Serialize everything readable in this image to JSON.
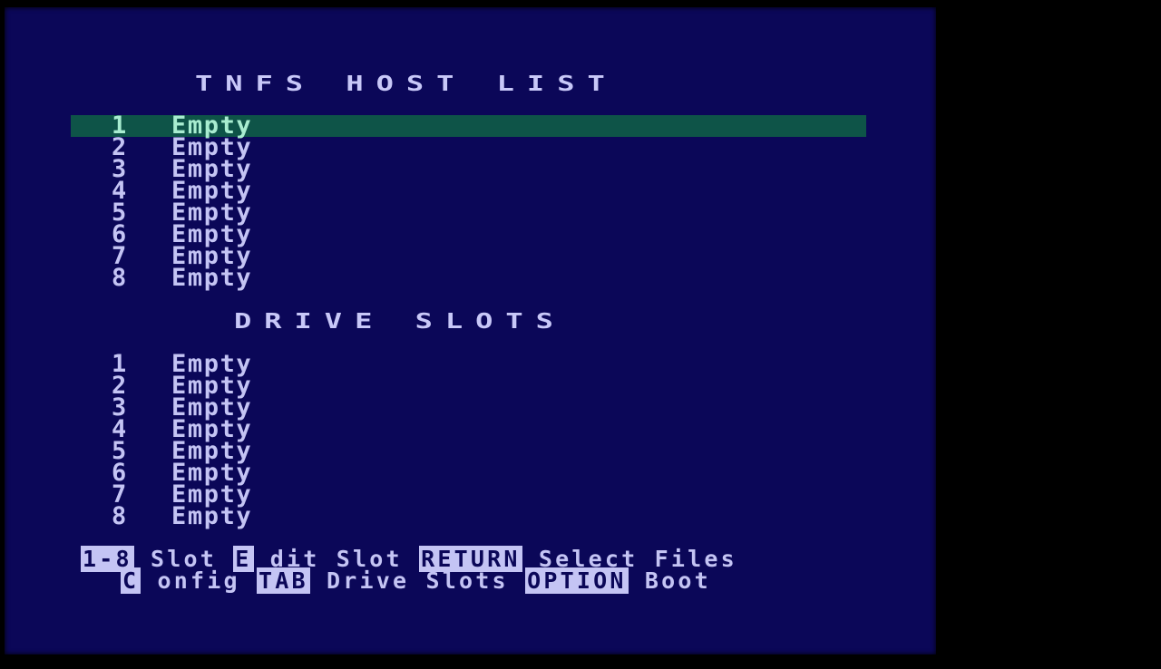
{
  "host_list": {
    "title": "TNFS HOST LIST",
    "selected_index": 0,
    "items": [
      {
        "num": "1",
        "label": "Empty"
      },
      {
        "num": "2",
        "label": "Empty"
      },
      {
        "num": "3",
        "label": "Empty"
      },
      {
        "num": "4",
        "label": "Empty"
      },
      {
        "num": "5",
        "label": "Empty"
      },
      {
        "num": "6",
        "label": "Empty"
      },
      {
        "num": "7",
        "label": "Empty"
      },
      {
        "num": "8",
        "label": "Empty"
      }
    ]
  },
  "drive_slots": {
    "title": "DRIVE SLOTS",
    "items": [
      {
        "num": "1",
        "label": "Empty"
      },
      {
        "num": "2",
        "label": "Empty"
      },
      {
        "num": "3",
        "label": "Empty"
      },
      {
        "num": "4",
        "label": "Empty"
      },
      {
        "num": "5",
        "label": "Empty"
      },
      {
        "num": "6",
        "label": "Empty"
      },
      {
        "num": "7",
        "label": "Empty"
      },
      {
        "num": "8",
        "label": "Empty"
      }
    ]
  },
  "help": {
    "line1": [
      {
        "key": "1-8",
        "text": " Slot "
      },
      {
        "key": "E",
        "text": " dit Slot "
      },
      {
        "key": "RETURN",
        "text": " Select Files"
      }
    ],
    "line2": [
      {
        "key": "C",
        "text": " onfig "
      },
      {
        "key": "TAB",
        "text": " Drive Slots "
      },
      {
        "key": "OPTION",
        "text": " Boot"
      }
    ]
  },
  "colors": {
    "background": "#0b0758",
    "text": "#c4c4f4",
    "highlight_bar": "#0e5448",
    "highlight_text": "#a8ecd0"
  }
}
